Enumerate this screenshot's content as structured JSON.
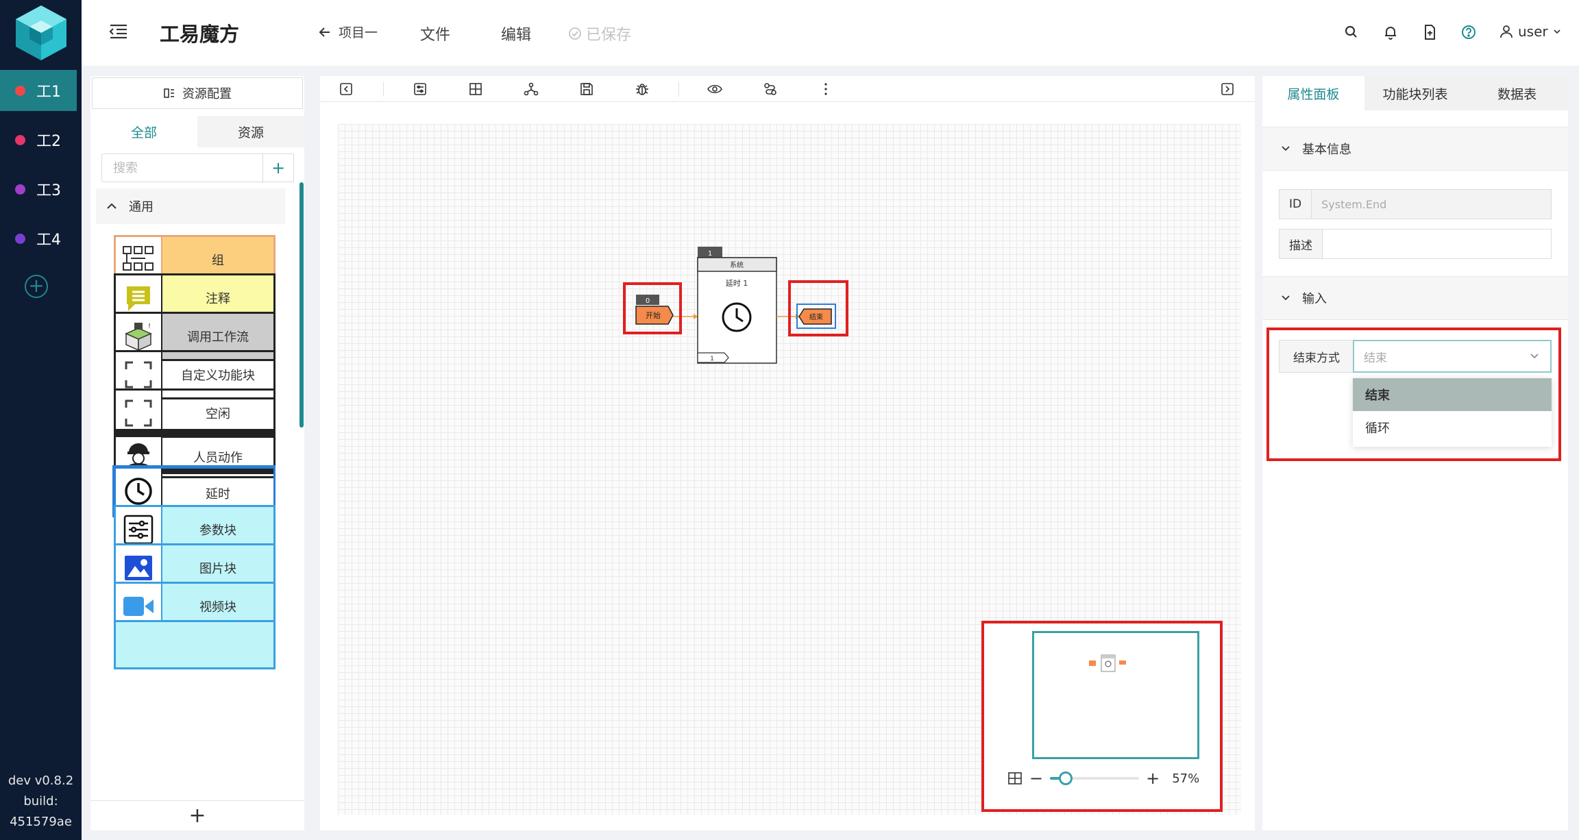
{
  "app": {
    "title": "工易魔方"
  },
  "header": {
    "back_label": "项目一",
    "file_label": "文件",
    "edit_label": "编辑",
    "saved_label": "已保存",
    "user_label": "user"
  },
  "rail": {
    "items": [
      {
        "label": "工1",
        "color": "#f04848",
        "active": true
      },
      {
        "label": "工2",
        "color": "#e8356a",
        "active": false
      },
      {
        "label": "工3",
        "color": "#a23fc8",
        "active": false
      },
      {
        "label": "工4",
        "color": "#7a3fd0",
        "active": false
      }
    ],
    "version": "dev v0.8.2",
    "build_label": "build:",
    "build_hash": "451579ae"
  },
  "left_panel": {
    "resource_config_label": "资源配置",
    "tabs": [
      "全部",
      "资源"
    ],
    "search_placeholder": "搜索",
    "group_label": "通用",
    "blocks": [
      {
        "label": "组",
        "bg": "#fccf7e",
        "border": "#e8a87a"
      },
      {
        "label": "注释",
        "bg": "#fbfaa6",
        "border": "#222"
      },
      {
        "label": "调用工作流",
        "bg": "#cccccc",
        "border": "#222"
      },
      {
        "label": "自定义功能块",
        "bg": "#ffffff",
        "border": "#222"
      },
      {
        "label": "空闲",
        "bg": "#ffffff",
        "border": "#222"
      },
      {
        "label": "人员动作",
        "bg": "#ffffff",
        "border": "#222"
      },
      {
        "label": "延时",
        "bg": "#ffffff",
        "border": "#2a7fd6"
      },
      {
        "label": "参数块",
        "bg": "#bff4f8",
        "border": "#3aa0e0"
      },
      {
        "label": "图片块",
        "bg": "#bff4f8",
        "border": "#3aa0e0"
      },
      {
        "label": "视频块",
        "bg": "#bff4f8",
        "border": "#3aa0e0"
      }
    ]
  },
  "canvas": {
    "start_node": {
      "badge": "0",
      "label": "开始"
    },
    "delay_node": {
      "badge": "1",
      "category": "系统",
      "name": "延时 1",
      "port": "1"
    },
    "end_node": {
      "label": "结束"
    },
    "minimap": {
      "zoom": "57%",
      "zoom_fraction": 0.57
    }
  },
  "right_panel": {
    "tabs": [
      "属性面板",
      "功能块列表",
      "数据表"
    ],
    "basic_info_label": "基本信息",
    "id_label": "ID",
    "id_value": "System.End",
    "desc_label": "描述",
    "desc_value": "",
    "input_label": "输入",
    "end_mode_label": "结束方式",
    "end_mode_placeholder": "结束",
    "end_mode_options": [
      "结束",
      "循环"
    ]
  },
  "colors": {
    "accent": "#1f8a8f",
    "rail_bg": "#0d1b33",
    "highlight_red": "#e02020",
    "node_orange": "#f58b4a"
  }
}
